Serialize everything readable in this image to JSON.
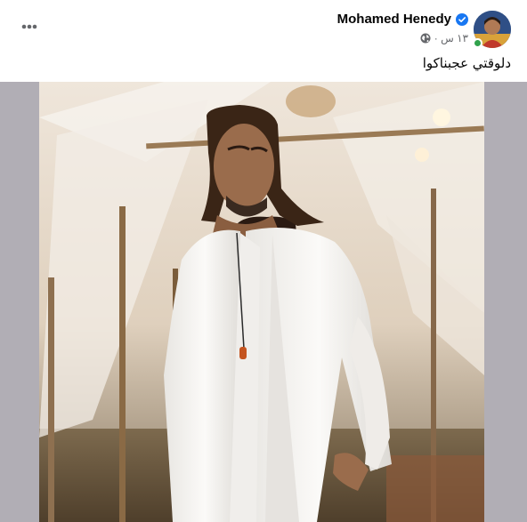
{
  "post": {
    "author": "Mohamed Henedy",
    "timestamp": "١٣ س ·",
    "caption": "دلوقتي عجبناكوا"
  },
  "icons": {
    "more": "more-horizontal-icon",
    "verified": "verified-badge-icon",
    "privacy": "globe-icon"
  },
  "colors": {
    "verified_blue": "#1877f2",
    "online_green": "#31a24c",
    "secondary_text": "#65676b",
    "media_background": "#b1aeb5"
  }
}
